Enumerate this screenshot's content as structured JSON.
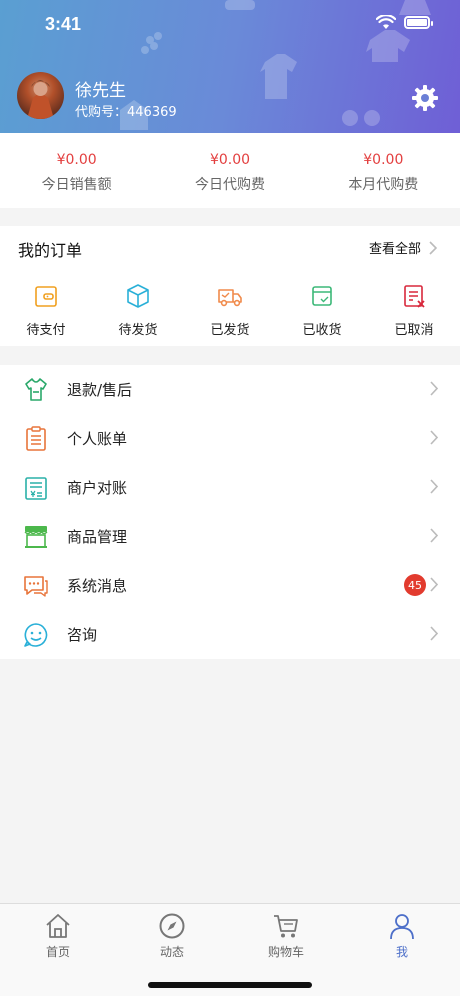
{
  "status": {
    "time": "3:41"
  },
  "profile": {
    "name": "徐先生",
    "id_label": "代购号：446369"
  },
  "stats": [
    {
      "value": "¥0.00",
      "label": "今日销售额"
    },
    {
      "value": "¥0.00",
      "label": "今日代购费"
    },
    {
      "value": "¥0.00",
      "label": "本月代购费"
    }
  ],
  "orders": {
    "title": "我的订单",
    "view_all": "查看全部",
    "items": [
      {
        "label": "待支付",
        "icon": "wallet-icon",
        "color": "#f0a020"
      },
      {
        "label": "待发货",
        "icon": "box-icon",
        "color": "#2ab0d8"
      },
      {
        "label": "已发货",
        "icon": "truck-icon",
        "color": "#f08a4b"
      },
      {
        "label": "已收货",
        "icon": "received-box-icon",
        "color": "#3cb878"
      },
      {
        "label": "已取消",
        "icon": "cancel-doc-icon",
        "color": "#d8283c"
      }
    ]
  },
  "menu": [
    {
      "label": "退款/售后",
      "icon": "refund-shirt-icon",
      "color": "#2aa86a"
    },
    {
      "label": "个人账单",
      "icon": "bill-icon",
      "color": "#e8743a"
    },
    {
      "label": "商户对账",
      "icon": "statement-icon",
      "color": "#2ab0a8"
    },
    {
      "label": "商品管理",
      "icon": "store-icon",
      "color": "#4cb84c"
    },
    {
      "label": "系统消息",
      "icon": "message-icon",
      "color": "#e8743a",
      "badge": "45"
    },
    {
      "label": "咨询",
      "icon": "smile-chat-icon",
      "color": "#2ab0d8"
    }
  ],
  "tabs": [
    {
      "label": "首页",
      "icon": "home-icon"
    },
    {
      "label": "动态",
      "icon": "compass-icon"
    },
    {
      "label": "购物车",
      "icon": "cart-icon"
    },
    {
      "label": "我",
      "icon": "user-icon",
      "active": true
    }
  ],
  "colors": {
    "accent": "#4d6fc9",
    "price": "#e33f3f",
    "badge": "#e23b2e"
  }
}
